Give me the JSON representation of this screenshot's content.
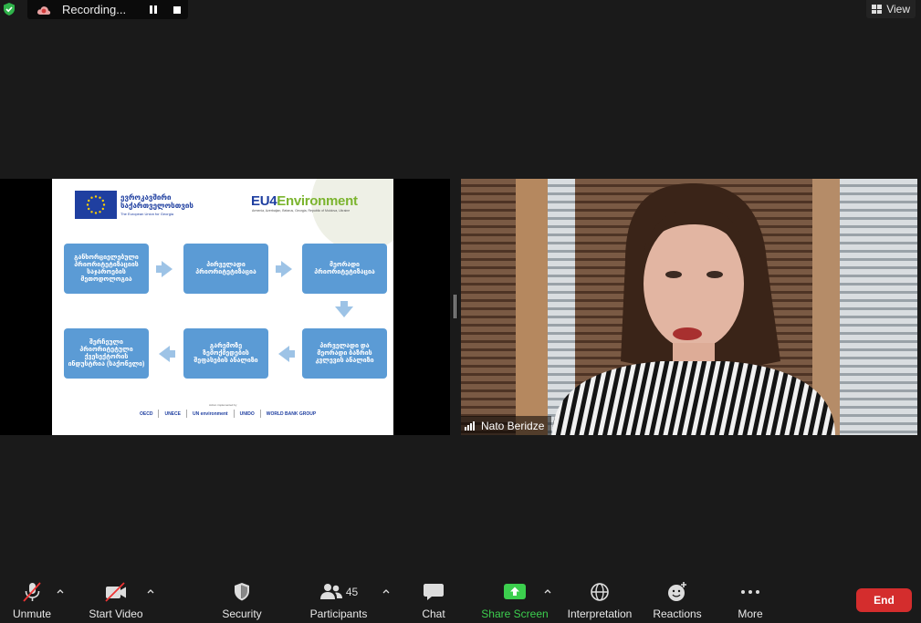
{
  "recording": {
    "label": "Recording..."
  },
  "view": {
    "label": "View"
  },
  "slide": {
    "eu_name_ka": "ევროკავშირი საქართველოსთვის",
    "eu_name_en": "The European Union for Georgia",
    "logo_part1": "EU4",
    "logo_part2": "Environment",
    "logo_subtitle": "Armenia, Azerbaijan, Belarus, Georgia, Republic of Moldova, Ukraine",
    "boxes": [
      "განხორციელებული პრიორიტეტიზაციის საჯაროების მეთოდოლოგია",
      "პირველადი პრიორიტეტიზაცია",
      "მეორადი პრიორიტეტიზაცია",
      "პირველადი და მეორადი ბაზრის კვლევის ანალიზი",
      "გარემოზე ზემოქმედების შეფასების ანალიზი",
      "შერჩეული პრიორიტეტული ქვესექტორის ინდუსტრია (საქონელი)"
    ],
    "partners_label": "Action implemented by",
    "partners": [
      "OECD",
      "UNECE",
      "UN environment",
      "UNIDO",
      "WORLD BANK GROUP"
    ]
  },
  "video": {
    "participant_name": "Nato Beridze"
  },
  "toolbar": {
    "unmute": "Unmute",
    "start_video": "Start Video",
    "security": "Security",
    "participants": "Participants",
    "participants_count": "45",
    "chat": "Chat",
    "share_screen": "Share Screen",
    "interpretation": "Interpretation",
    "reactions": "Reactions",
    "more": "More",
    "end": "End"
  },
  "colors": {
    "background": "#1a1a1a",
    "share_green": "#3ccf4e",
    "end_red": "#d42d2d",
    "slide_box_blue": "#5b9bd5",
    "slide_arrow_blue": "#9dc3e6"
  }
}
